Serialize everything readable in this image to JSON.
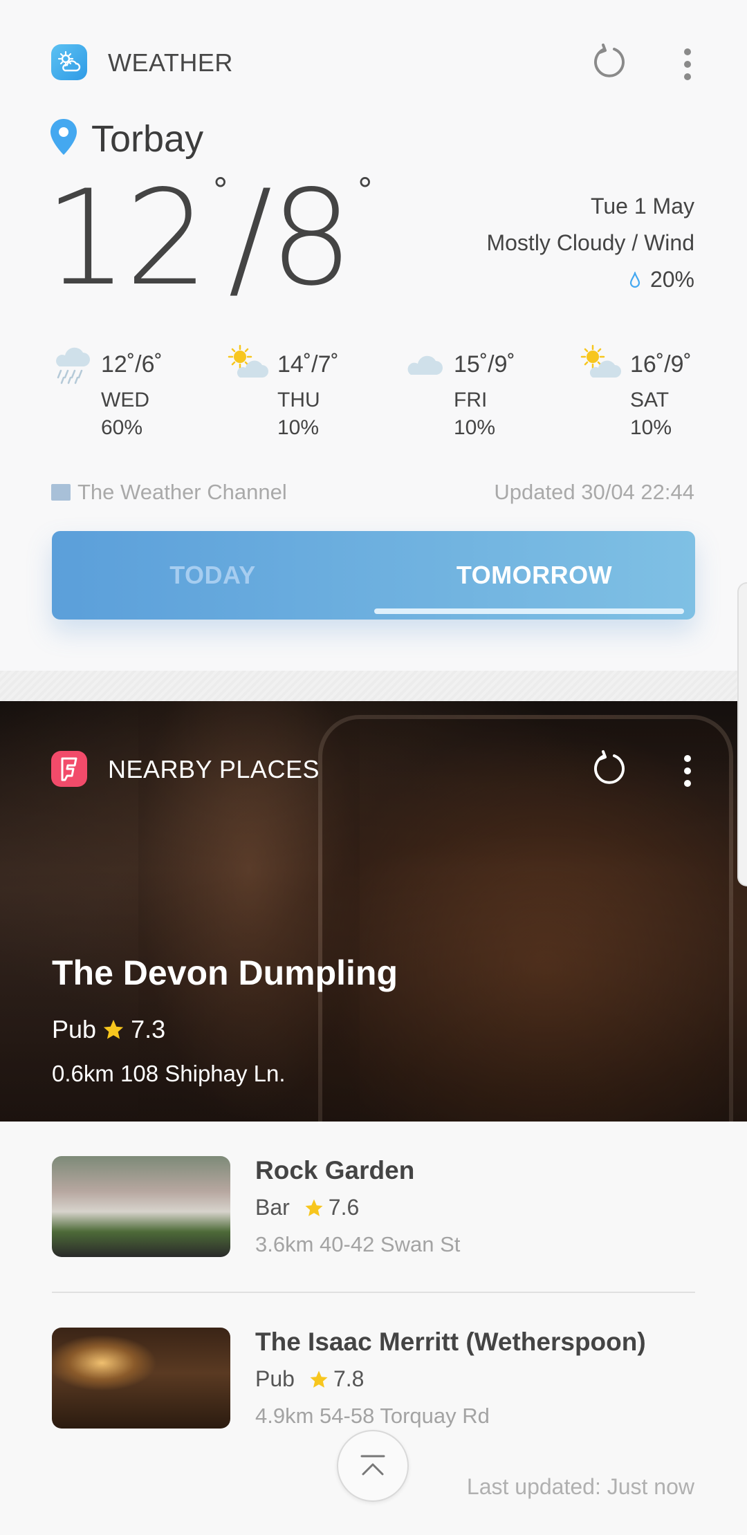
{
  "weather": {
    "header_title": "WEATHER",
    "location": "Torbay",
    "temp_high": "12",
    "temp_low": "8",
    "date": "Tue 1 May",
    "condition": "Mostly Cloudy / Wind",
    "rain_chance": "20%",
    "forecast": [
      {
        "temp": "12˚/6˚",
        "day": "WED",
        "pct": "60%",
        "icon": "rain-icon"
      },
      {
        "temp": "14˚/7˚",
        "day": "THU",
        "pct": "10%",
        "icon": "partly-sunny-icon"
      },
      {
        "temp": "15˚/9˚",
        "day": "FRI",
        "pct": "10%",
        "icon": "cloudy-icon"
      },
      {
        "temp": "16˚/9˚",
        "day": "SAT",
        "pct": "10%",
        "icon": "partly-sunny-icon"
      }
    ],
    "source": "The Weather Channel",
    "updated": "Updated 30/04 22:44",
    "tabs": {
      "today": "TODAY",
      "tomorrow": "TOMORROW",
      "selected": "TOMORROW"
    }
  },
  "nearby": {
    "header_title": "NEARBY PLACES",
    "featured": {
      "name": "The Devon Dumpling",
      "category": "Pub",
      "rating": "7.3",
      "address": "0.6km 108 Shiphay Ln."
    },
    "places": [
      {
        "name": "Rock Garden",
        "category": "Bar",
        "rating": "7.6",
        "address": "3.6km 40-42 Swan St"
      },
      {
        "name": "The Isaac Merritt (Wetherspoon)",
        "category": "Pub",
        "rating": "7.8",
        "address": "4.9km 54-58 Torquay Rd"
      }
    ]
  },
  "footer": {
    "last_updated": "Last updated: Just now"
  },
  "colors": {
    "accent_blue": "#5b9fda",
    "foursquare_pink": "#f24b6a",
    "star": "#f7c61e"
  }
}
